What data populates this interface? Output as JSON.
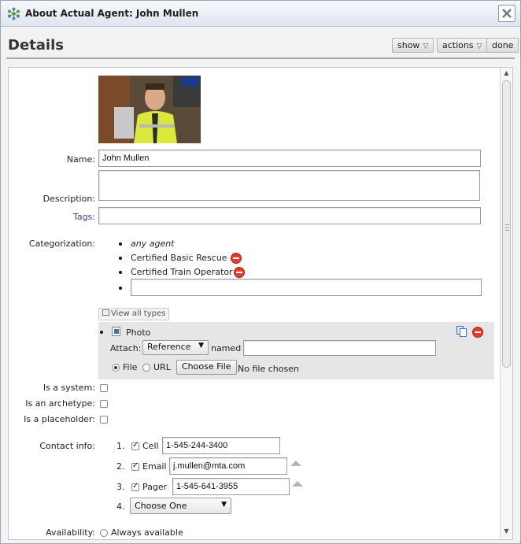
{
  "window": {
    "title": "About Actual Agent: John Mullen"
  },
  "header": {
    "heading": "Details",
    "show_label": "show",
    "actions_label": "actions",
    "done_label": "done"
  },
  "form": {
    "name_label": "Name:",
    "name_value": "John Mullen",
    "description_label": "Description:",
    "description_value": "",
    "tags_label": "Tags:",
    "tags_value": "",
    "categorization_label": "Categorization:",
    "categories": [
      {
        "label": "any agent",
        "italic": true,
        "removable": false
      },
      {
        "label": "Certified Basic Rescue",
        "italic": false,
        "removable": true
      },
      {
        "label": "Certified Train Operator",
        "italic": false,
        "removable": true
      }
    ],
    "new_category_value": "",
    "view_all_types_label": "View all types"
  },
  "photo": {
    "label": "Photo",
    "attach_label": "Attach:",
    "attach_select": "Reference",
    "named_label": "named",
    "named_value": "",
    "file_option": "File",
    "url_option": "URL",
    "choose_file_label": "Choose File",
    "no_file_text": "No file chosen"
  },
  "flags": {
    "is_system_label": "Is a system:",
    "is_archetype_label": "Is an archetype:",
    "is_placeholder_label": "Is a placeholder:"
  },
  "contact": {
    "label": "Contact info:",
    "items": [
      {
        "num": "1.",
        "type": "Cell",
        "value": "1-545-244-3400",
        "checked": true
      },
      {
        "num": "2.",
        "type": "Email",
        "value": "j.mullen@mta.com",
        "checked": true
      },
      {
        "num": "3.",
        "type": "Pager",
        "value": "1-545-641-3955",
        "checked": true
      }
    ],
    "new_num": "4.",
    "new_select": "Choose One"
  },
  "availability": {
    "label": "Availability:",
    "option": "Always available"
  }
}
